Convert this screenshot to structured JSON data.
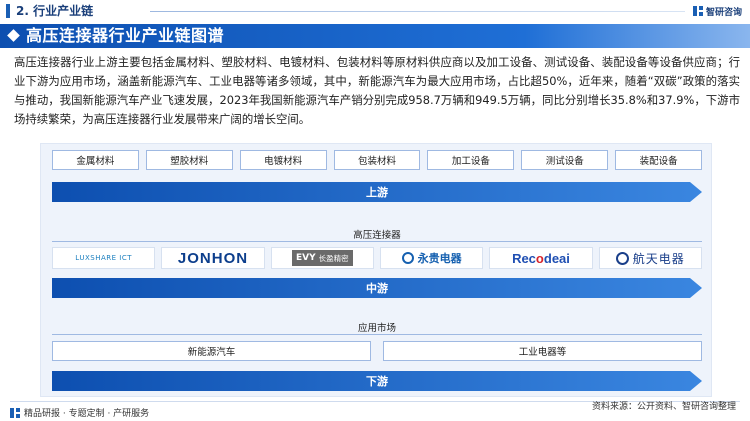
{
  "header": {
    "section_title": "2. 行业产业链",
    "brand_name": "智研咨询"
  },
  "banner": {
    "title": "高压连接器行业产业链图谱"
  },
  "intro_text": "高压连接器行业上游主要包括金属材料、塑胶材料、电镀材料、包装材料等原材料供应商以及加工设备、测试设备、装配设备等设备供应商；行业下游为应用市场，涵盖新能源汽车、工业电器等诸多领域，其中，新能源汽车为最大应用市场，占比超50%，近年来，随着“双碳”政策的落实与推动，我国新能源汽车产业飞速发展，2023年我国新能源汽车产销分别完成958.7万辆和949.5万辆，同比分别增长35.8%和37.9%，下游市场持续繁荣，为高压连接器行业发展带来广阔的增长空间。",
  "upstream": {
    "items": [
      "金属材料",
      "塑胶材料",
      "电镀材料",
      "包装材料",
      "加工设备",
      "测试设备",
      "装配设备"
    ],
    "stage_label": "上游"
  },
  "midstream": {
    "sub_label": "高压连接器",
    "stage_label": "中游",
    "logos": [
      {
        "name": "luxshare",
        "text": "LUXSHARE ICT"
      },
      {
        "name": "jonhon",
        "text": "JONHON"
      },
      {
        "name": "evy",
        "mark": "EVY",
        "text": "长盈精密"
      },
      {
        "name": "yonggui",
        "text": "永贵电器"
      },
      {
        "name": "recodeal",
        "text_a": "Rec",
        "text_o": "o",
        "text_b": "deai"
      },
      {
        "name": "hangtian",
        "text": "航天电器"
      }
    ]
  },
  "downstream": {
    "sub_label": "应用市场",
    "items": [
      "新能源汽车",
      "工业电器等"
    ],
    "stage_label": "下游"
  },
  "footer": {
    "left_text": "精品研报 · 专题定制 · 产研服务",
    "source_text": "资料来源：公开资料、智研咨询整理"
  },
  "colors": {
    "primary": "#1a5fb4",
    "banner_start": "#0d4fb0",
    "arrow_fill": "#1f68cc",
    "frame_bg": "#eef3fb"
  }
}
